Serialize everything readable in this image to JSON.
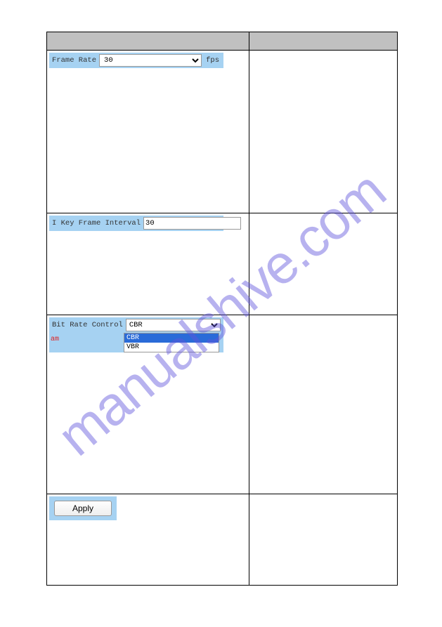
{
  "watermark": "manualshive.com",
  "frame_rate": {
    "label": "Frame Rate",
    "value": "30",
    "unit": "fps"
  },
  "key_frame_interval": {
    "label": "I Key Frame Interval",
    "value": "30"
  },
  "bit_rate_control": {
    "label": "Bit Rate Control",
    "value": "CBR",
    "secondary_label": "am",
    "options": [
      {
        "label": "CBR",
        "selected": true
      },
      {
        "label": "VBR",
        "selected": false
      }
    ]
  },
  "apply": {
    "label": "Apply"
  }
}
